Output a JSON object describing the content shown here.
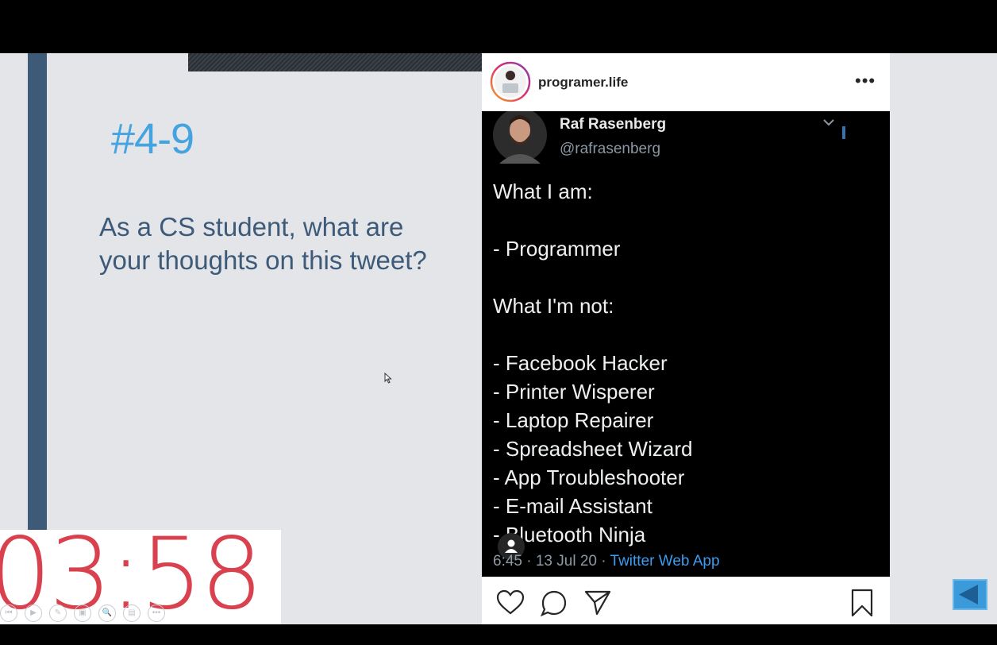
{
  "slide": {
    "title": "#4-9",
    "body": "As a CS student, what are your thoughts on this tweet?"
  },
  "timer": {
    "value": "03:58"
  },
  "toolbar": {
    "tools": [
      "⏮",
      "▶",
      "✎",
      "▣",
      "🔍",
      "▤",
      "•••"
    ]
  },
  "post": {
    "username": "programer.life",
    "more_label": "•••",
    "tweet": {
      "name": "Raf Rasenberg",
      "handle": "@rafrasenberg",
      "lines": [
        "What I am:",
        "",
        "- Programmer",
        "",
        "What I'm not:",
        "",
        "- Facebook Hacker",
        "- Printer Wisperer",
        "- Laptop Repairer",
        "- Spreadsheet Wizard",
        "- App Troubleshooter",
        "- E-mail Assistant",
        "- Bluetooth Ninja"
      ],
      "time": "6:45 · 13 Jul 20 · ",
      "app": "Twitter Web App"
    }
  },
  "colors": {
    "accent": "#45a3e0",
    "sidebar": "#3d5a78",
    "timer": "#d9414f",
    "twitter_link": "#3d9bf0"
  }
}
